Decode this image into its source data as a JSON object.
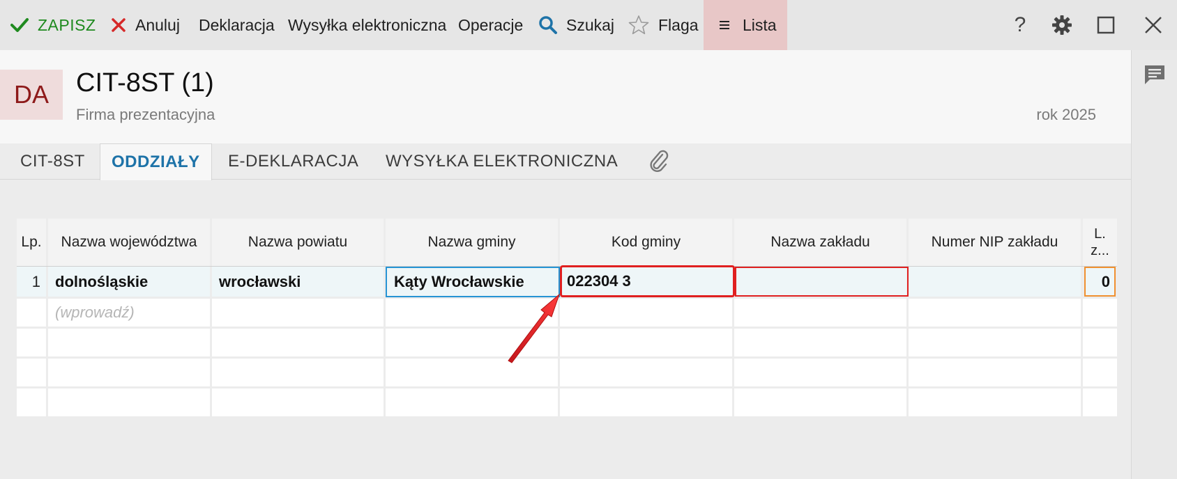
{
  "toolbar": {
    "save": "ZAPISZ",
    "cancel": "Anuluj",
    "declaration": "Deklaracja",
    "e_send": "Wysyłka elektroniczna",
    "operations": "Operacje",
    "search": "Szukaj",
    "flag": "Flaga",
    "list": "Lista",
    "help": "?"
  },
  "header": {
    "badge": "DA",
    "title": "CIT-8ST (1)",
    "company": "Firma prezentacyjna",
    "year": "rok 2025"
  },
  "tabs": [
    "CIT-8ST",
    "ODDZIAŁY",
    "E-DEKLARACJA",
    "WYSYŁKA ELEKTRONICZNA"
  ],
  "grid": {
    "headers": [
      "Lp.",
      "Nazwa województwa",
      "Nazwa powiatu",
      "Nazwa gminy",
      "Kod gminy",
      "Nazwa zakładu",
      "Numer NIP zakładu",
      "L. z..."
    ],
    "rows": [
      [
        "1",
        "dolnośląskie",
        "wrocławski",
        "Kąty Wrocławskie",
        "022304 3",
        "",
        "",
        "0"
      ]
    ],
    "new_row_placeholder": "(wprowadź)"
  },
  "colors": {
    "accent": "#1e73a8",
    "save_green": "#1f8a1f",
    "cancel_red": "#d62828",
    "badge_bg": "#efdcdc",
    "badge_text": "#8e1a1a",
    "error_red": "#e02020"
  }
}
